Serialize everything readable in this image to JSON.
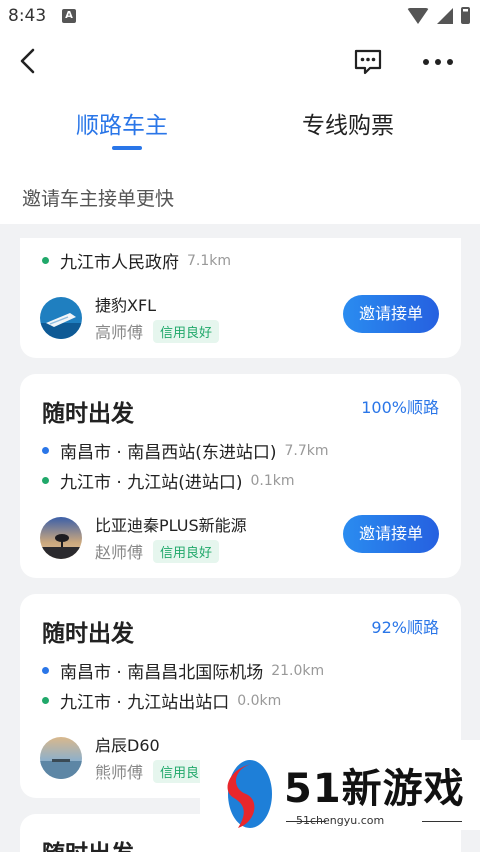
{
  "status_bar": {
    "time": "8:43",
    "notification_icon": "A"
  },
  "header": {
    "tabs": [
      {
        "label": "顺路车主",
        "active": true
      },
      {
        "label": "专线购票",
        "active": false
      }
    ],
    "subtitle": "邀请车主接单更快",
    "accent_color": "#2a76e8"
  },
  "cards": [
    {
      "stops": [
        {
          "place": "九江市人民政府",
          "distance": "7.1km",
          "dot": "green"
        }
      ],
      "driver": {
        "car": "捷豹XFL",
        "name": "高师傅",
        "badge": "信用良好",
        "avatar_icon": "yacht-photo-avatar"
      },
      "button": "邀请接单"
    },
    {
      "title": "随时出发",
      "route_match": "100%顺路",
      "stops": [
        {
          "place": "南昌市 · 南昌西站(东进站口)",
          "distance": "7.7km",
          "dot": "blue"
        },
        {
          "place": "九江市 · 九江站(进站口)",
          "distance": "0.1km",
          "dot": "green"
        }
      ],
      "driver": {
        "car": "比亚迪秦PLUS新能源",
        "name": "赵师傅",
        "badge": "信用良好",
        "avatar_icon": "sunset-tree-avatar"
      },
      "button": "邀请接单"
    },
    {
      "title": "随时出发",
      "route_match": "92%顺路",
      "stops": [
        {
          "place": "南昌市 · 南昌昌北国际机场",
          "distance": "21.0km",
          "dot": "blue"
        },
        {
          "place": "九江市 · 九江站出站口",
          "distance": "0.0km",
          "dot": "green"
        }
      ],
      "driver": {
        "car": "启辰D60",
        "name": "熊师傅",
        "badge": "信用良",
        "avatar_icon": "beach-avatar"
      }
    },
    {
      "title": "随时出发"
    }
  ],
  "watermark": {
    "brand": "51新游戏",
    "url": "51chengyu.com"
  }
}
